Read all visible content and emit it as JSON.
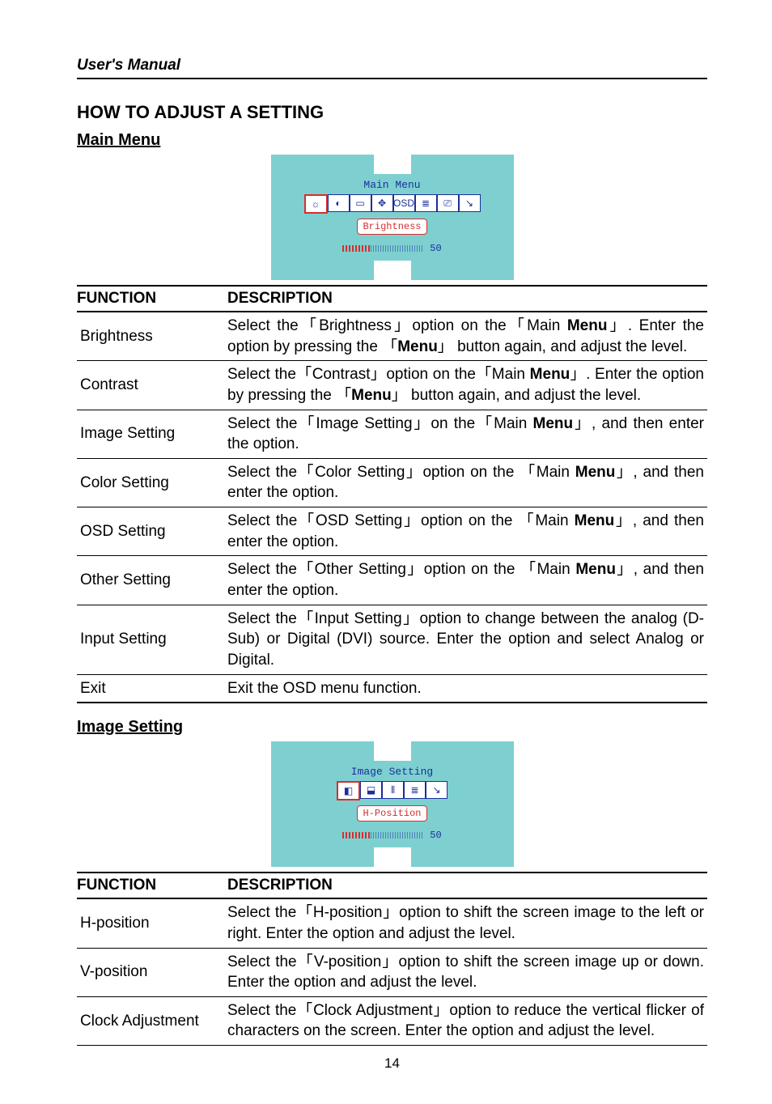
{
  "doc_title": "User's Manual",
  "section_title": "HOW TO ADJUST A SETTING",
  "main_menu_label": "Main Menu",
  "image_setting_label": "Image Setting",
  "page_number": "14",
  "osd_main": {
    "title": "Main Menu",
    "selected_label": "Brightness",
    "value": "50",
    "icons": [
      "brightness",
      "contrast",
      "image",
      "color",
      "osd",
      "other",
      "input",
      "exit"
    ]
  },
  "osd_image": {
    "title": "Image Setting",
    "selected_label": "H-Position",
    "value": "50",
    "icons": [
      "h-position",
      "v-position",
      "clock",
      "phase",
      "exit"
    ]
  },
  "table_headers": {
    "function": "FUNCTION",
    "description": "DESCRIPTION"
  },
  "main_table": [
    {
      "function": "Brightness",
      "description": "Select the「Brightness」option on the「Main Menu」. Enter the option by pressing the 「Menu」 button again, and adjust the level."
    },
    {
      "function": "Contrast",
      "description": "Select the「Contrast」option on the「Main Menu」. Enter the option by pressing the 「Menu」 button again, and adjust the level."
    },
    {
      "function": "Image Setting",
      "description": "Select the「Image Setting」on the「Main Menu」, and then enter the option."
    },
    {
      "function": "Color Setting",
      "description": "Select the「Color Setting」option on the 「Main Menu」, and then enter the option."
    },
    {
      "function": "OSD Setting",
      "description": "Select the「OSD Setting」option on the 「Main Menu」, and then enter the option."
    },
    {
      "function": "Other Setting",
      "description": "Select the「Other Setting」option on the 「Main Menu」, and then enter the option."
    },
    {
      "function": "Input Setting",
      "description": "Select the「Input Setting」option to change between the analog (D-Sub) or Digital (DVI) source. Enter the option and select Analog or Digital."
    },
    {
      "function": "Exit",
      "description": "Exit the OSD menu function."
    }
  ],
  "image_table": [
    {
      "function": "H-position",
      "description": "Select the「H-position」option to shift the screen image to the left or right. Enter the option and adjust the level."
    },
    {
      "function": "V-position",
      "description": "Select the「V-position」option to shift the screen image up or down. Enter the option and adjust the level."
    },
    {
      "function": "Clock Adjustment",
      "description": "Select the「Clock Adjustment」option to reduce the vertical flicker of characters on the screen. Enter the option and adjust the level."
    }
  ]
}
